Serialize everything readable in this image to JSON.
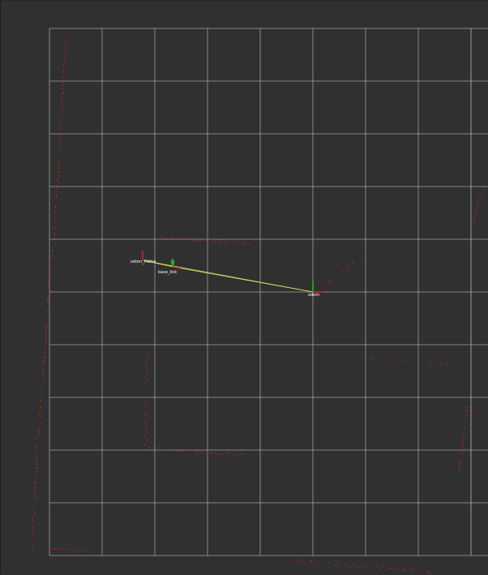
{
  "viewport": {
    "background": "#303030",
    "grid_color": "#a0a0a0",
    "laser_color": "#ff2020",
    "tf_link_color": "#d8d860"
  },
  "frames": [
    {
      "id": "map",
      "label": "odom",
      "icon": "axes-icon"
    },
    {
      "id": "child1",
      "label": "odom_frame",
      "icon": "axes-icon"
    },
    {
      "id": "child2",
      "label": "base_link",
      "icon": "axes-icon"
    }
  ]
}
